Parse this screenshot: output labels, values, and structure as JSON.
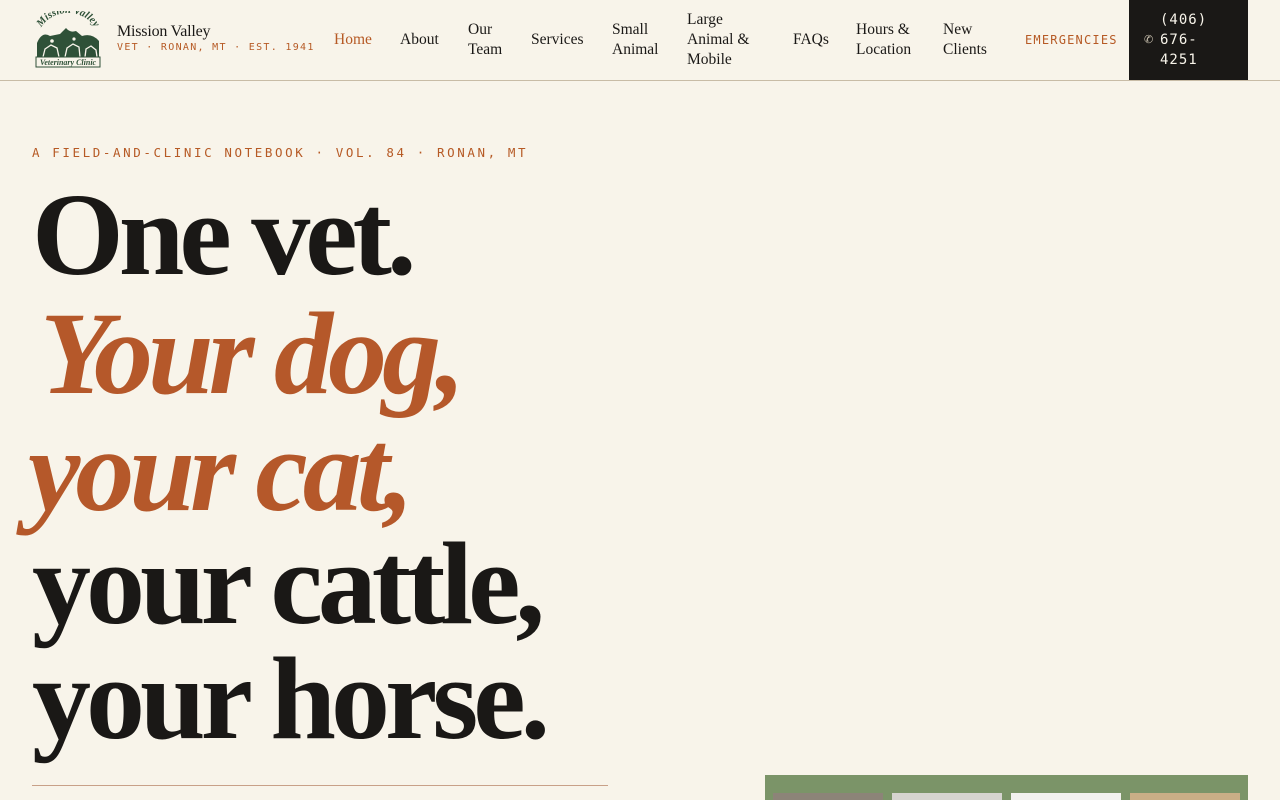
{
  "brand": {
    "name": "Mission Valley",
    "tagline": "VET · RONAN, MT · EST. 1941",
    "logo": {
      "icon": "mission-valley-veterinary-clinic-logo",
      "arc_text_top": "Mission Valley",
      "arc_text_bottom": "Veterinary Clinic"
    }
  },
  "nav": {
    "items": [
      {
        "id": "home",
        "label": "Home",
        "active": true
      },
      {
        "id": "about",
        "label": "About"
      },
      {
        "id": "team",
        "label": "Our Team"
      },
      {
        "id": "services",
        "label": "Services"
      },
      {
        "id": "small-animal",
        "label": "Small Animal"
      },
      {
        "id": "large-animal",
        "label": "Large Animal & Mobile"
      },
      {
        "id": "faqs",
        "label": "FAQs"
      },
      {
        "id": "hours",
        "label": "Hours & Location"
      },
      {
        "id": "new-clients",
        "label": "New Clients"
      }
    ],
    "emergencies_label": "EMERGENCIES",
    "phone": {
      "icon": "phone-icon",
      "number": "(406) 676-4251"
    }
  },
  "hero": {
    "kicker": "A FIELD-AND-CLINIC NOTEBOOK · VOL. 84 · RONAN, MT",
    "headline": [
      "One vet.",
      "Your dog,",
      "your cat,",
      "your cattle,",
      "your horse."
    ]
  },
  "colors": {
    "background": "#f8f4ea",
    "ink": "#1a1816",
    "accent": "#b65a25",
    "phone_button": "#1a1816",
    "photo_panel": "#7b9468"
  }
}
